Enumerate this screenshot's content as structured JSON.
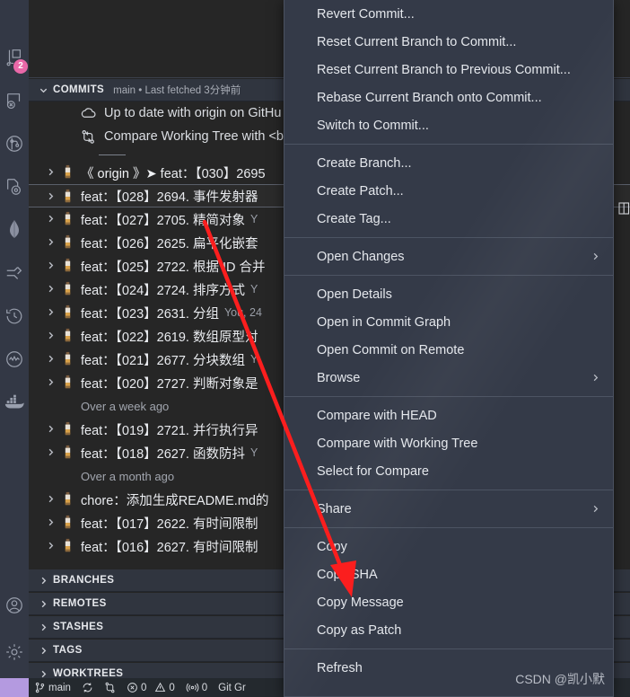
{
  "window": {
    "background": "#1f1f1f",
    "panel_background": "#262626",
    "accent_purple": "#b49ae0",
    "badge_color": "#e968a8",
    "menu_background": "#343a48",
    "annotation_color": "#fb1e1e"
  },
  "activity_bar": {
    "items": [
      {
        "name": "source-control-icon",
        "badge": "2"
      },
      {
        "name": "testing-icon",
        "badge": ""
      },
      {
        "name": "git-graph-icon",
        "badge": ""
      },
      {
        "name": "gitlens-inspect-icon",
        "badge": ""
      },
      {
        "name": "mongodb-leaf-icon",
        "badge": ""
      },
      {
        "name": "remote-explorer-icon",
        "badge": ""
      },
      {
        "name": "timeline-history-icon",
        "badge": ""
      },
      {
        "name": "activity-monitor-icon",
        "badge": ""
      },
      {
        "name": "docker-whale-icon",
        "badge": ""
      }
    ],
    "bottom_items": [
      {
        "name": "accounts-icon"
      },
      {
        "name": "settings-gear-icon"
      }
    ]
  },
  "commits_panel": {
    "header": {
      "title": "COMMITS",
      "subtitle": "main • Last fetched 3分钟前",
      "chevron": "chevron-down-icon"
    },
    "info_rows": [
      {
        "icon": "cloud-icon",
        "label": "Up to date with origin on GitHu"
      },
      {
        "icon": "compare-icon",
        "label": "Compare Working Tree with <b"
      }
    ],
    "rows": [
      {
        "type": "commit",
        "origin": "《 origin 》➤",
        "text": "feat：【030】2695",
        "meta": "",
        "selected": false
      },
      {
        "type": "commit",
        "origin": "",
        "text": "feat：【028】2694. 事件发射器",
        "meta": "",
        "selected": true
      },
      {
        "type": "commit",
        "origin": "",
        "text": "feat：【027】2705. 精简对象",
        "meta": "Y",
        "selected": false
      },
      {
        "type": "commit",
        "origin": "",
        "text": "feat：【026】2625. 扁平化嵌套",
        "meta": "",
        "selected": false
      },
      {
        "type": "commit",
        "origin": "",
        "text": "feat：【025】2722. 根据 ID 合并",
        "meta": "",
        "selected": false
      },
      {
        "type": "commit",
        "origin": "",
        "text": "feat：【024】2724. 排序方式",
        "meta": "Y",
        "selected": false
      },
      {
        "type": "commit",
        "origin": "",
        "text": "feat：【023】2631. 分组",
        "meta": "You, 24",
        "selected": false
      },
      {
        "type": "commit",
        "origin": "",
        "text": "feat：【022】2619. 数组原型对",
        "meta": "",
        "selected": false
      },
      {
        "type": "commit",
        "origin": "",
        "text": "feat：【021】2677. 分块数组",
        "meta": "Y",
        "selected": false
      },
      {
        "type": "commit",
        "origin": "",
        "text": "feat：【020】2727. 判断对象是",
        "meta": "",
        "selected": false
      },
      {
        "type": "group",
        "text": "Over a week ago"
      },
      {
        "type": "commit",
        "origin": "",
        "text": "feat：【019】2721. 并行执行异",
        "meta": "",
        "selected": false
      },
      {
        "type": "commit",
        "origin": "",
        "text": "feat：【018】2627. 函数防抖",
        "meta": "Y",
        "selected": false
      },
      {
        "type": "group",
        "text": "Over a month ago"
      },
      {
        "type": "commit",
        "origin": "",
        "text": "chore：添加生成README.md的",
        "meta": "",
        "selected": false
      },
      {
        "type": "commit",
        "origin": "",
        "text": "feat：【017】2622. 有时间限制",
        "meta": "",
        "selected": false
      },
      {
        "type": "commit",
        "origin": "",
        "text": "feat：【016】2627. 有时间限制",
        "meta": "",
        "selected": false
      }
    ],
    "sections": [
      {
        "label": "BRANCHES",
        "chevron": "chevron-right-icon"
      },
      {
        "label": "REMOTES",
        "chevron": "chevron-right-icon"
      },
      {
        "label": "STASHES",
        "chevron": "chevron-right-icon"
      },
      {
        "label": "TAGS",
        "chevron": "chevron-right-icon"
      },
      {
        "label": "WORKTREES",
        "chevron": "chevron-right-icon"
      }
    ]
  },
  "context_menu": {
    "groups": [
      {
        "items": [
          {
            "label": "Revert Commit...",
            "submenu": false
          },
          {
            "label": "Reset Current Branch to Commit...",
            "submenu": false
          },
          {
            "label": "Reset Current Branch to Previous Commit...",
            "submenu": false
          },
          {
            "label": "Rebase Current Branch onto Commit...",
            "submenu": false
          },
          {
            "label": "Switch to Commit...",
            "submenu": false
          }
        ]
      },
      {
        "items": [
          {
            "label": "Create Branch...",
            "submenu": false
          },
          {
            "label": "Create Patch...",
            "submenu": false
          },
          {
            "label": "Create Tag...",
            "submenu": false
          }
        ]
      },
      {
        "items": [
          {
            "label": "Open Changes",
            "submenu": true
          }
        ]
      },
      {
        "items": [
          {
            "label": "Open Details",
            "submenu": false
          },
          {
            "label": "Open in Commit Graph",
            "submenu": false
          },
          {
            "label": "Open Commit on Remote",
            "submenu": false
          },
          {
            "label": "Browse",
            "submenu": true
          }
        ]
      },
      {
        "items": [
          {
            "label": "Compare with HEAD",
            "submenu": false
          },
          {
            "label": "Compare with Working Tree",
            "submenu": false
          },
          {
            "label": "Select for Compare",
            "submenu": false
          }
        ]
      },
      {
        "items": [
          {
            "label": "Share",
            "submenu": true
          }
        ]
      },
      {
        "items": [
          {
            "label": "Copy",
            "submenu": false
          },
          {
            "label": "Copy SHA",
            "submenu": false
          },
          {
            "label": "Copy Message",
            "submenu": false
          },
          {
            "label": "Copy as Patch",
            "submenu": false
          }
        ]
      },
      {
        "items": [
          {
            "label": "Refresh",
            "submenu": false
          }
        ]
      }
    ]
  },
  "watermark": {
    "text": "CSDN @凯小默"
  },
  "status_bar": {
    "branch": "main",
    "sync_icon": "sync-icon",
    "branch_icon": "source-control-icon",
    "changes_icon": "git-compare-icon",
    "errors": "0",
    "warnings": "0",
    "ports": "0",
    "right_label": "Git Gr"
  }
}
